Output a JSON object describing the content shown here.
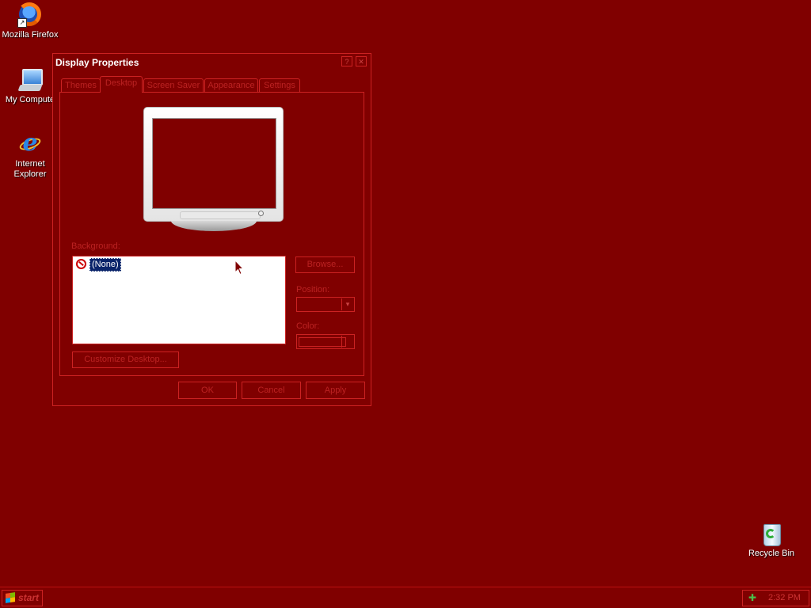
{
  "desktop": {
    "icons": [
      {
        "label": "Mozilla Firefox",
        "icon": "firefox-icon"
      },
      {
        "label": "My Compute",
        "icon": "my-computer-icon"
      },
      {
        "label": "Internet Explorer",
        "icon": "internet-explorer-icon"
      },
      {
        "label": "Recycle Bin",
        "icon": "recycle-bin-icon"
      }
    ],
    "background_color": "#800000"
  },
  "dialog": {
    "title": "Display Properties",
    "help_button": "?",
    "close_button": "✕",
    "tabs": [
      {
        "label": "Themes",
        "active": false
      },
      {
        "label": "Desktop",
        "active": true
      },
      {
        "label": "Screen Saver",
        "active": false
      },
      {
        "label": "Appearance",
        "active": false
      },
      {
        "label": "Settings",
        "active": false
      }
    ],
    "background_label": "Background:",
    "background_list": [
      {
        "label": "(None)",
        "icon": "none-icon",
        "selected": true
      }
    ],
    "browse_button": "Browse...",
    "position_label": "Position:",
    "position_value": "",
    "color_label": "Color:",
    "color_value": "#800000",
    "customize_button": "Customize Desktop...",
    "ok_button": "OK",
    "cancel_button": "Cancel",
    "apply_button": "Apply"
  },
  "taskbar": {
    "start_label": "start",
    "clock": "2:32 PM",
    "tray_icon": "network-icon"
  }
}
